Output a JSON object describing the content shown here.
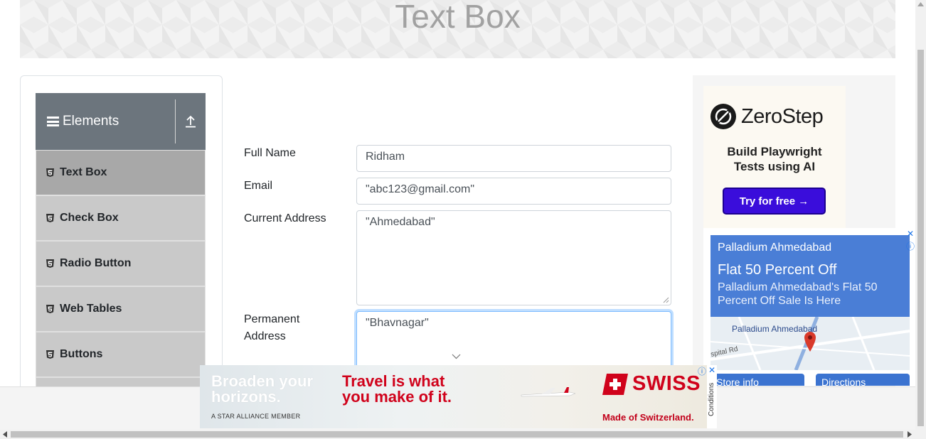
{
  "page": {
    "title": "Text Box"
  },
  "sidebar": {
    "group_title": "Elements",
    "items": [
      {
        "label": "Text Box"
      },
      {
        "label": "Check Box"
      },
      {
        "label": "Radio Button"
      },
      {
        "label": "Web Tables"
      },
      {
        "label": "Buttons"
      }
    ]
  },
  "form": {
    "full_name_label": "Full Name",
    "full_name_value": "Ridham",
    "email_label": "Email",
    "email_value": "\"abc123@gmail.com\"",
    "current_address_label": "Current Address",
    "current_address_value": "\"Ahmedabad\"",
    "permanent_address_label": "Permanent Address",
    "permanent_address_value": "\"Bhavnagar\""
  },
  "ads": {
    "zerostep": {
      "brand": "ZeroStep",
      "tagline": "Build Playwright Tests using AI",
      "cta": "Try for free →"
    },
    "palladium": {
      "brand": "Palladium Ahmedabad",
      "headline": "Flat 50 Percent Off",
      "subtext": "Palladium Ahmedabad's Flat 50 Percent Off Sale Is Here",
      "map_label": "Palladium Ahmedabad",
      "road_label": "spital Rd",
      "btn_store": "Store info",
      "btn_directions": "Directions"
    },
    "swiss": {
      "line1": "Broaden your horizons.",
      "line2": "Travel is what you make of it.",
      "alliance": "A STAR ALLIANCE MEMBER",
      "logo": "SWISS",
      "slogan": "Made of Switzerland.",
      "conditions": "Conditions"
    }
  },
  "colors": {
    "menu_header": "#6c757d",
    "menu_item": "#c9c9c9",
    "menu_active": "#a8a8a8",
    "swiss_red": "#d0021b",
    "zerostep_button": "#3a0ddb",
    "palladium_blue": "#4a7ed6"
  }
}
